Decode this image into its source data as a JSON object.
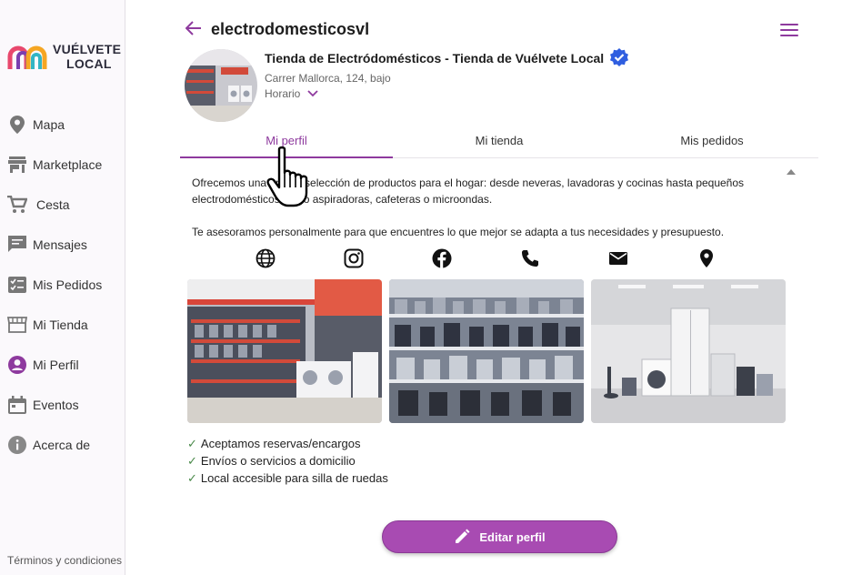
{
  "sidebar": {
    "logo": {
      "line1": "VUÉLVETE",
      "line2": "LOCAL"
    },
    "items": [
      {
        "label": "Mapa",
        "icon": "map-pin-icon"
      },
      {
        "label": "Marketplace",
        "icon": "store-icon"
      },
      {
        "label": "Cesta",
        "icon": "cart-icon"
      },
      {
        "label": "Mensajes",
        "icon": "chat-icon"
      },
      {
        "label": "Mis Pedidos",
        "icon": "checklist-icon"
      },
      {
        "label": "Mi Tienda",
        "icon": "storefront-icon"
      },
      {
        "label": "Mi Perfil",
        "icon": "user-icon"
      },
      {
        "label": "Eventos",
        "icon": "calendar-icon"
      },
      {
        "label": "Acerca de",
        "icon": "info-icon"
      }
    ],
    "terms": "Términos y condiciones"
  },
  "header": {
    "username": "electrodomesticosvl"
  },
  "profile": {
    "name": "Tienda de Electródomésticos - Tienda de Vuélvete Local",
    "address": "Carrer Mallorca, 124, bajo",
    "horario": "Horario"
  },
  "tabs": [
    {
      "label": "Mi perfil",
      "active": true
    },
    {
      "label": "Mi tienda",
      "active": false
    },
    {
      "label": "Mis pedidos",
      "active": false
    }
  ],
  "description": {
    "p1": "Ofrecemos una amplia selección de productos para el hogar: desde neveras, lavadoras y cocinas hasta pequeños electrodomésticos como aspiradoras, cafeteras o microondas.",
    "p2": "Te asesoramos personalmente para que encuentres lo que mejor se adapta a tus necesidades y presupuesto."
  },
  "socials": [
    "globe-icon",
    "instagram-icon",
    "facebook-icon",
    "phone-icon",
    "mail-icon",
    "location-icon"
  ],
  "features": [
    "Aceptamos reservas/encargos",
    "Envíos o servicios a domicilio",
    "Local accesible para silla de ruedas"
  ],
  "check_mark": "✓",
  "edit_button": "Editar perfil",
  "colors": {
    "accent": "#8e3a9e",
    "button": "#a84bb2",
    "verified": "#2f5ee0"
  }
}
